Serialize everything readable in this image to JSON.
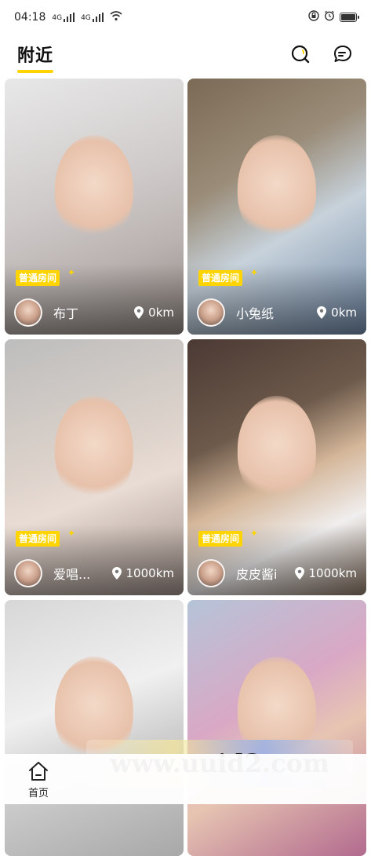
{
  "status": {
    "time": "04:18",
    "net1": "4G",
    "net2": "4G",
    "right_icons": [
      "lock-icon",
      "alarm-icon",
      "battery-icon"
    ]
  },
  "header": {
    "tab_label": "附近",
    "accent": "#FFD400",
    "icons": [
      "search-icon",
      "message-icon"
    ]
  },
  "cards": [
    {
      "badge": "普通房间",
      "name": "布丁",
      "distance": "0km"
    },
    {
      "badge": "普通房间",
      "name": "小兔纸",
      "distance": "0km"
    },
    {
      "badge": "普通房间",
      "name": "爱唱...",
      "distance": "1000km"
    },
    {
      "badge": "普通房间",
      "name": "皮皮酱i",
      "distance": "1000km"
    },
    {
      "badge": "",
      "name": "",
      "distance": ""
    },
    {
      "badge": "",
      "name": "",
      "distance": ""
    }
  ],
  "nav": {
    "home_label": "首页"
  },
  "watermark": "www.uuid2.com"
}
